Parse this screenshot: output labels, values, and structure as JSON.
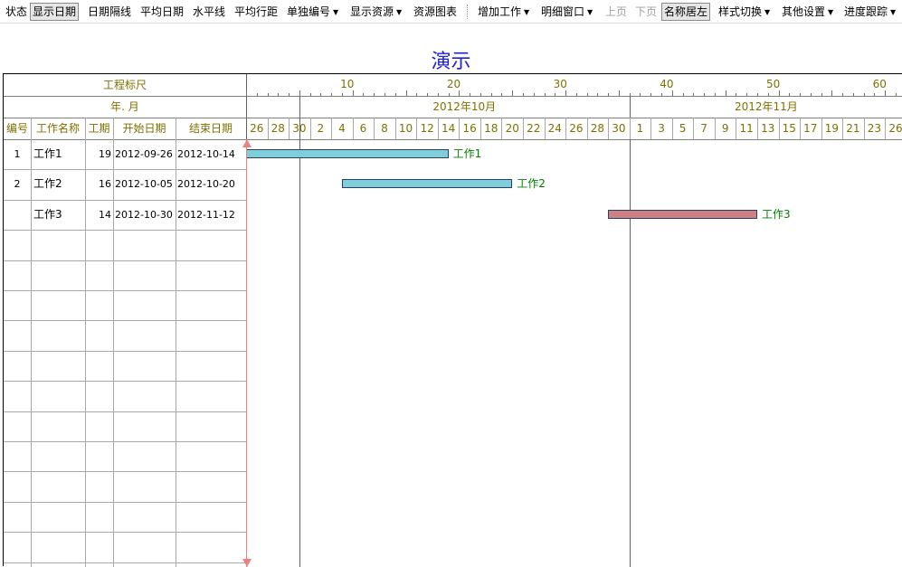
{
  "toolbar": {
    "items": [
      {
        "label": "状态",
        "pressed": false,
        "dropdown": false,
        "disabled": false
      },
      {
        "label": "显示日期",
        "pressed": true,
        "dropdown": false,
        "disabled": false
      },
      {
        "label": "日期隔线",
        "pressed": false,
        "dropdown": false,
        "disabled": false
      },
      {
        "label": "平均日期",
        "pressed": false,
        "dropdown": false,
        "disabled": false
      },
      {
        "label": "水平线",
        "pressed": false,
        "dropdown": false,
        "disabled": false
      },
      {
        "label": "平均行距",
        "pressed": false,
        "dropdown": false,
        "disabled": false
      },
      {
        "label": "单独编号",
        "pressed": false,
        "dropdown": true,
        "disabled": false
      },
      {
        "label": "显示资源",
        "pressed": false,
        "dropdown": true,
        "disabled": false
      },
      {
        "label": "资源图表",
        "pressed": false,
        "dropdown": false,
        "disabled": false
      },
      {
        "label": "增加工作",
        "pressed": false,
        "dropdown": true,
        "disabled": false
      },
      {
        "label": "明细窗口",
        "pressed": false,
        "dropdown": true,
        "disabled": false
      },
      {
        "label": "上页",
        "pressed": false,
        "dropdown": false,
        "disabled": true
      },
      {
        "label": "下页",
        "pressed": false,
        "dropdown": false,
        "disabled": true
      },
      {
        "label": "名称居左",
        "pressed": true,
        "dropdown": false,
        "disabled": false
      },
      {
        "label": "样式切换",
        "pressed": false,
        "dropdown": true,
        "disabled": false
      },
      {
        "label": "其他设置",
        "pressed": false,
        "dropdown": true,
        "disabled": false
      },
      {
        "label": "进度跟踪",
        "pressed": false,
        "dropdown": true,
        "disabled": false
      }
    ]
  },
  "title": "演示",
  "header": {
    "scale_label": "工程标尺",
    "yearmonth_label": "年. 月",
    "columns": [
      "编号",
      "工作名称",
      "工期",
      "开始日期",
      "结束日期"
    ],
    "ruler_numbers": [
      "10",
      "20",
      "30",
      "40",
      "50",
      "60"
    ],
    "months": [
      "2012年10月",
      "2012年11月"
    ],
    "day_labels": [
      "26",
      "28",
      "30",
      "2",
      "4",
      "6",
      "8",
      "10",
      "12",
      "14",
      "16",
      "18",
      "20",
      "22",
      "24",
      "26",
      "28",
      "30",
      "1",
      "3",
      "5",
      "7",
      "9",
      "11",
      "13",
      "15",
      "17",
      "19",
      "21",
      "23",
      "26"
    ]
  },
  "tasks": [
    {
      "id": "1",
      "name": "工作1",
      "duration": "19",
      "start": "2012-09-26",
      "end": "2012-10-14",
      "day_start": 0,
      "day_end": 19,
      "color": "#7ecfd9"
    },
    {
      "id": "2",
      "name": "工作2",
      "duration": "16",
      "start": "2012-10-05",
      "end": "2012-10-20",
      "day_start": 9,
      "day_end": 25,
      "color": "#7ecfd9"
    },
    {
      "id": "",
      "name": "工作3",
      "duration": "14",
      "start": "2012-10-30",
      "end": "2012-11-12",
      "day_start": 34,
      "day_end": 48,
      "color": "#cf8080"
    }
  ],
  "colors": {
    "header_text": "#807000",
    "title": "#2020d8",
    "bar_label": "#008000",
    "today_line": "#f08080"
  }
}
